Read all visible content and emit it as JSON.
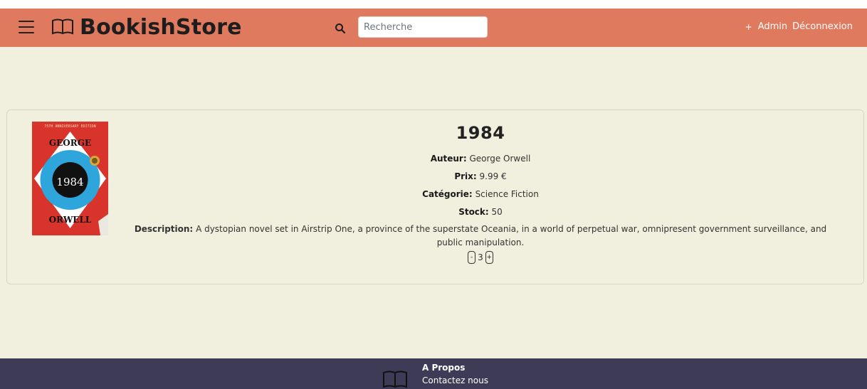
{
  "navbar": {
    "brand": "BookishStore",
    "search_placeholder": "Recherche",
    "add_label": "+",
    "admin_label": "Admin",
    "logout_label": "Déconnexion"
  },
  "book": {
    "title": "1984",
    "cover": {
      "banner": "75TH ANNIVERSARY EDITION",
      "author_first": "GEORGE",
      "author_last": "ORWELL",
      "title": "1984"
    },
    "author_label": "Auteur:",
    "author": "George Orwell",
    "price_label": "Prix:",
    "price": "9.99 €",
    "category_label": "Catégorie:",
    "category": "Science Fiction",
    "stock_label": "Stock:",
    "stock": "50",
    "description_label": "Description:",
    "description": "A dystopian novel set in Airstrip One, a province of the superstate Oceania, in a world of perpetual war, omnipresent government surveillance, and public manipulation.",
    "quantity": {
      "decrement_label": "-",
      "value": "3",
      "increment_label": "+"
    }
  },
  "footer": {
    "about": "A Propos",
    "contact": "Contactez nous"
  },
  "colors": {
    "navbar": "#e07a5f",
    "background": "#f1efdd",
    "footer": "#3d3b55",
    "cover_red": "#d8342c",
    "cover_blue": "#2ea6dc"
  }
}
